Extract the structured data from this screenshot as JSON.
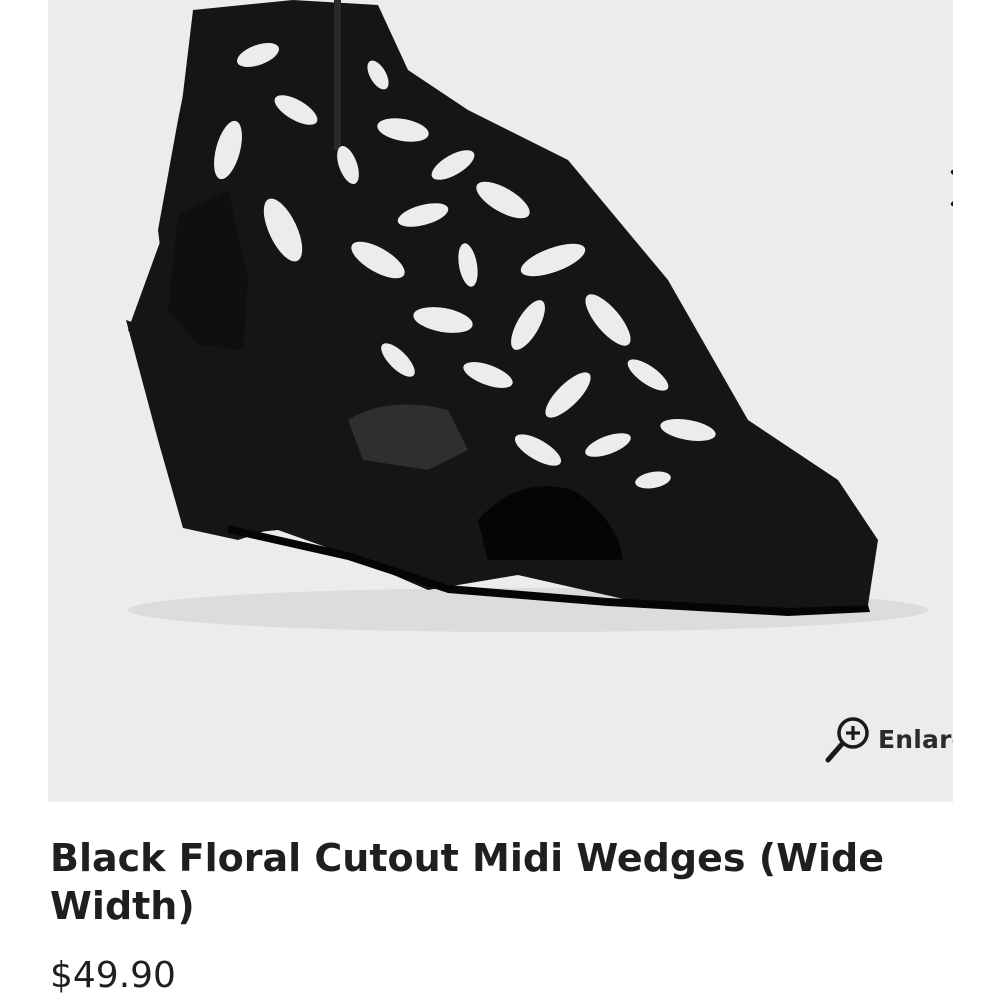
{
  "product": {
    "title": "Black Floral Cutout Midi Wedges (Wide Width)",
    "price": "$49.90",
    "image_alt": "Black floral cutout midi wedge sandal"
  },
  "gallery": {
    "enlarge_label": "Enlarge",
    "next_icon": "chevron-right-icon",
    "enlarge_icon": "magnifier-plus-icon",
    "background_color": "#ececec"
  },
  "colors": {
    "shoe": "#141414",
    "text": "#1f1f1f"
  }
}
